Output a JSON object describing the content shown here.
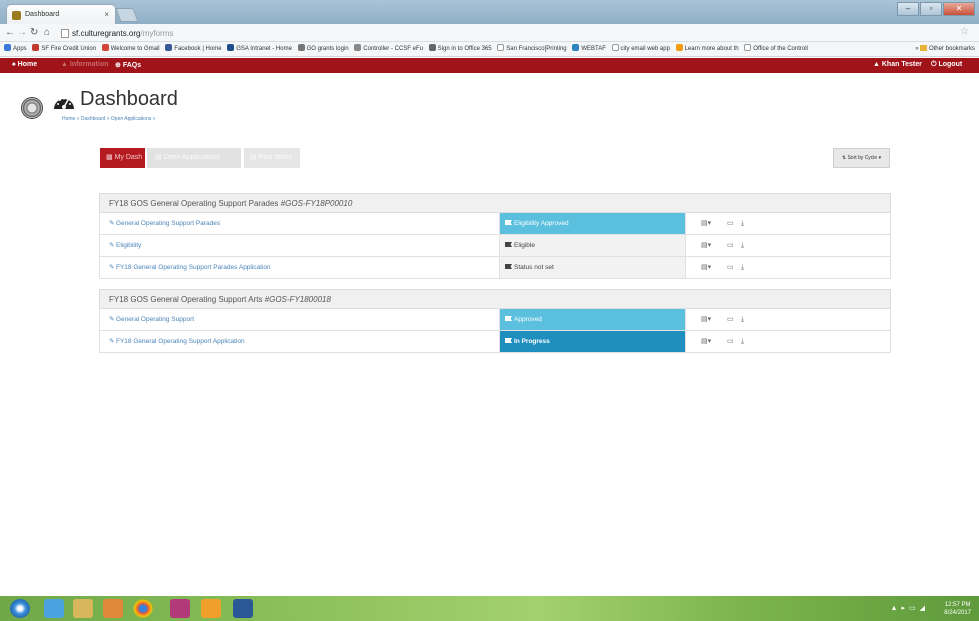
{
  "browser": {
    "tab_title": "Dashboard",
    "tab_close": "×",
    "url_domain": "sf.culturegrants.org",
    "url_path": "/myforms",
    "bookmarks": [
      "Apps",
      "SF Fire Credit Union",
      "Welcome to Gmail",
      "Facebook | Home",
      "GSA Intranet - Home",
      "GO grants login",
      "Controller - CCSF eFu",
      "Sign in to Office 365",
      "San Francisco[Printing",
      "WEBTAF",
      "city email web app",
      "Learn more about th",
      "Office of the Controll"
    ],
    "other_bookmarks": "Other bookmarks",
    "window_controls": [
      "–",
      "▫",
      "✕"
    ]
  },
  "sitenav": {
    "home": "Home",
    "information": "Information",
    "faqs": "FAQs",
    "user": "Khan Tester",
    "logout": "Logout"
  },
  "header": {
    "title": "Dashboard",
    "breadcrumb": "Home » Dashboard » Open Applications »"
  },
  "tabs": {
    "my_dash": "My Dash",
    "open_applications": "Open Applications",
    "past_items": "Past Items",
    "sort": "Sort by Cycle ▾"
  },
  "groups": [
    {
      "title": "FY18 GOS General Operating Support Parades",
      "code": "#GOS-FY18P00010",
      "rows": [
        {
          "name": "General Operating Support Parades",
          "status": "Eligibility Approved",
          "style": "light"
        },
        {
          "name": "Eligibility",
          "status": "Eligible",
          "style": "none"
        },
        {
          "name": "FY18 General Operating Support Parades Application",
          "status": "Status not set",
          "style": "none"
        }
      ]
    },
    {
      "title": "FY18 GOS General Operating Support Arts",
      "code": "#GOS-FY1800018",
      "rows": [
        {
          "name": "General Operating Support",
          "status": "Approved",
          "style": "light"
        },
        {
          "name": "FY18 General Operating Support Application",
          "status": "In Progress",
          "style": "dark"
        }
      ]
    }
  ],
  "taskbar": {
    "time": "12:57 PM",
    "date": "8/24/2017"
  }
}
